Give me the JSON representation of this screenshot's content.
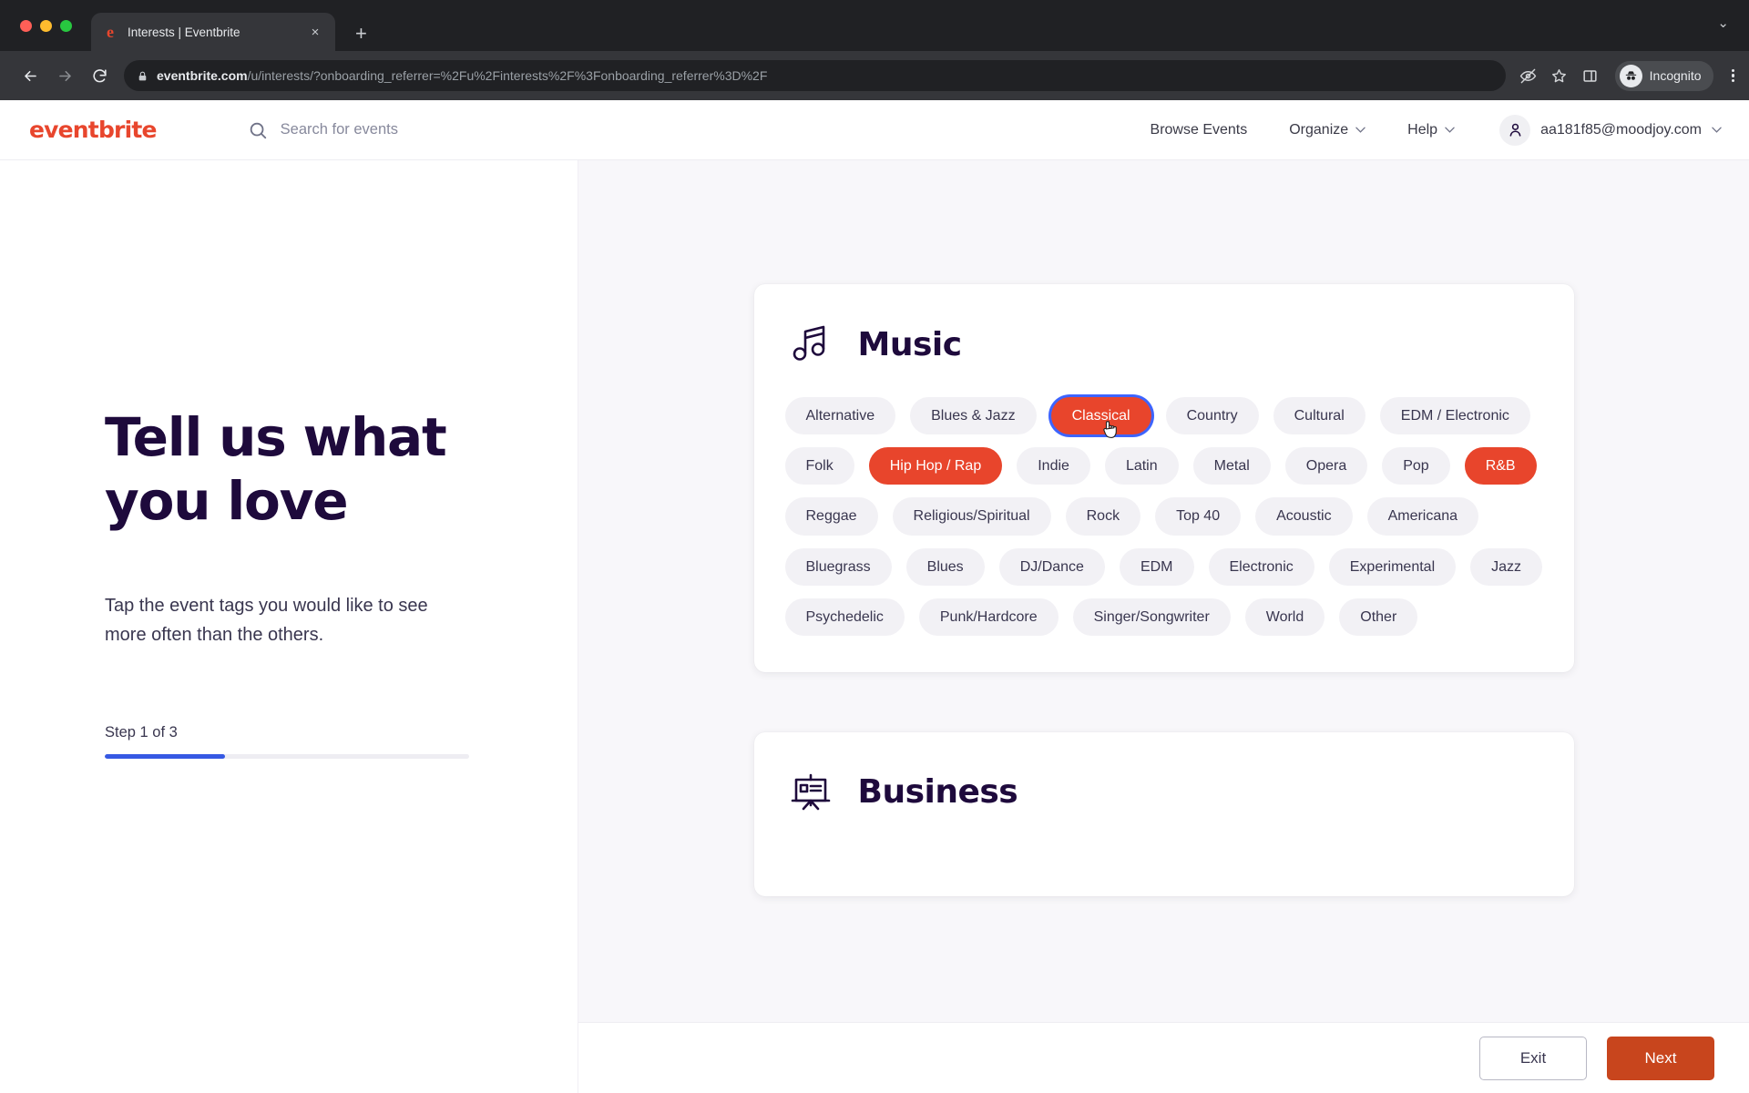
{
  "browser": {
    "tab": {
      "title": "Interests | Eventbrite",
      "favicon": "eventbrite-e-icon",
      "close": "×"
    },
    "new_tab_label": "+",
    "tabstrip_menu": "⌄",
    "url": {
      "host": "eventbrite.com",
      "rest": "/u/interests/?onboarding_referrer=%2Fu%2Finterests%2F%3Fonboarding_referrer%3D%2F"
    },
    "profile_label": "Incognito",
    "icons": [
      "back-icon",
      "forward-icon",
      "reload-icon",
      "lock-icon",
      "eye-off-icon",
      "star-icon",
      "side-panel-icon",
      "incognito-icon",
      "kebab-menu-icon"
    ]
  },
  "header": {
    "logo": "eventbrite",
    "search_placeholder": "Search for events",
    "search_value": "",
    "nav": [
      {
        "label": "Browse Events",
        "has_chevron": false
      },
      {
        "label": "Organize",
        "has_chevron": true
      },
      {
        "label": "Help",
        "has_chevron": true
      }
    ],
    "account_email": "aa181f85@moodjoy.com"
  },
  "left": {
    "headline_line1": "Tell us what",
    "headline_line2": "you love",
    "subtext": "Tap the event tags you would like to see more often than the others.",
    "step_label": "Step 1 of 3",
    "progress_percent": 33,
    "progress_color": "#3659e3"
  },
  "categories": [
    {
      "name": "Music",
      "icon": "music-note-icon",
      "tags": [
        {
          "label": "Alternative",
          "selected": false,
          "focused": false
        },
        {
          "label": "Blues & Jazz",
          "selected": false,
          "focused": false
        },
        {
          "label": "Classical",
          "selected": true,
          "focused": true
        },
        {
          "label": "Country",
          "selected": false,
          "focused": false
        },
        {
          "label": "Cultural",
          "selected": false,
          "focused": false
        },
        {
          "label": "EDM / Electronic",
          "selected": false,
          "focused": false
        },
        {
          "label": "Folk",
          "selected": false,
          "focused": false
        },
        {
          "label": "Hip Hop / Rap",
          "selected": true,
          "focused": false
        },
        {
          "label": "Indie",
          "selected": false,
          "focused": false
        },
        {
          "label": "Latin",
          "selected": false,
          "focused": false
        },
        {
          "label": "Metal",
          "selected": false,
          "focused": false
        },
        {
          "label": "Opera",
          "selected": false,
          "focused": false
        },
        {
          "label": "Pop",
          "selected": false,
          "focused": false
        },
        {
          "label": "R&B",
          "selected": true,
          "focused": false
        },
        {
          "label": "Reggae",
          "selected": false,
          "focused": false
        },
        {
          "label": "Religious/Spiritual",
          "selected": false,
          "focused": false
        },
        {
          "label": "Rock",
          "selected": false,
          "focused": false
        },
        {
          "label": "Top 40",
          "selected": false,
          "focused": false
        },
        {
          "label": "Acoustic",
          "selected": false,
          "focused": false
        },
        {
          "label": "Americana",
          "selected": false,
          "focused": false
        },
        {
          "label": "Bluegrass",
          "selected": false,
          "focused": false
        },
        {
          "label": "Blues",
          "selected": false,
          "focused": false
        },
        {
          "label": "DJ/Dance",
          "selected": false,
          "focused": false
        },
        {
          "label": "EDM",
          "selected": false,
          "focused": false
        },
        {
          "label": "Electronic",
          "selected": false,
          "focused": false
        },
        {
          "label": "Experimental",
          "selected": false,
          "focused": false
        },
        {
          "label": "Jazz",
          "selected": false,
          "focused": false
        },
        {
          "label": "Psychedelic",
          "selected": false,
          "focused": false
        },
        {
          "label": "Punk/Hardcore",
          "selected": false,
          "focused": false
        },
        {
          "label": "Singer/Songwriter",
          "selected": false,
          "focused": false
        },
        {
          "label": "World",
          "selected": false,
          "focused": false
        },
        {
          "label": "Other",
          "selected": false,
          "focused": false
        }
      ]
    },
    {
      "name": "Business",
      "icon": "presentation-board-icon",
      "tags": []
    }
  ],
  "footer": {
    "exit_label": "Exit",
    "next_label": "Next",
    "next_color": "#c8451d"
  }
}
